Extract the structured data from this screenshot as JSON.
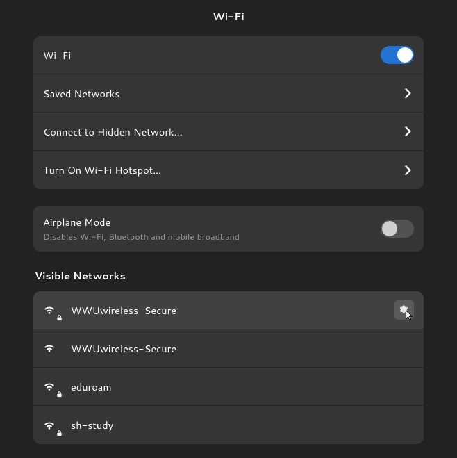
{
  "title": "Wi-Fi",
  "settings": {
    "wifi_label": "Wi-Fi",
    "wifi_enabled": true,
    "saved_networks_label": "Saved Networks",
    "hidden_network_label": "Connect to Hidden Network…",
    "hotspot_label": "Turn On Wi-Fi Hotspot…"
  },
  "airplane": {
    "label": "Airplane Mode",
    "sub": "Disables Wi-Fi, Bluetooth and mobile broadband",
    "enabled": false
  },
  "visible_networks_header": "Visible Networks",
  "networks": [
    {
      "name": "WWUwireless-Secure",
      "locked": true,
      "hovered": true,
      "has_gear": true
    },
    {
      "name": "WWUwireless-Secure",
      "locked": false,
      "hovered": false,
      "has_gear": false
    },
    {
      "name": "eduroam",
      "locked": true,
      "hovered": false,
      "has_gear": false
    },
    {
      "name": "sh-study",
      "locked": true,
      "hovered": false,
      "has_gear": false
    }
  ],
  "colors": {
    "accent": "#2173d1",
    "bg": "#222222",
    "row": "#353535",
    "row_hover": "#414141"
  }
}
